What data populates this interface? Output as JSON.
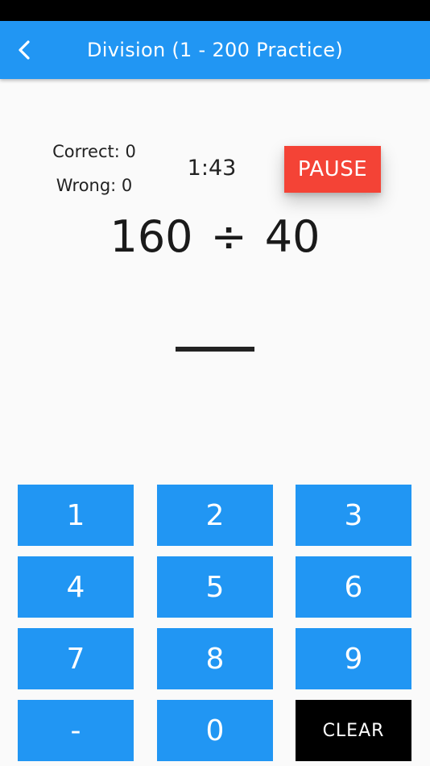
{
  "app_bar": {
    "title": "Division (1 - 200 Practice)",
    "color": "#2196f3"
  },
  "stats": {
    "correct_label": "Correct: 0",
    "wrong_label": "Wrong: 0",
    "timer": "1:43"
  },
  "pause_button": {
    "label": "PAUSE",
    "color": "#f44336"
  },
  "problem": {
    "dividend": "160",
    "operator": "÷",
    "divisor": "40"
  },
  "keypad": {
    "keys": [
      "1",
      "2",
      "3",
      "4",
      "5",
      "6",
      "7",
      "8",
      "9",
      "-",
      "0",
      "CLEAR"
    ],
    "key_color": "#2196f3",
    "clear_color": "#000000"
  }
}
